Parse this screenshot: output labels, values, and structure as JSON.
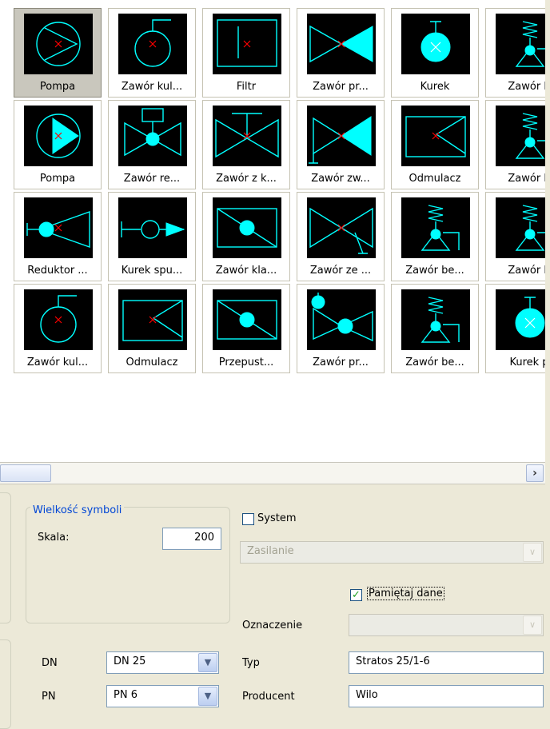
{
  "gallery": {
    "items": [
      {
        "label": "Pompa",
        "icon": "pump-icon",
        "selected": true
      },
      {
        "label": "Zawór kul...",
        "icon": "ball-valve-icon"
      },
      {
        "label": "Filtr",
        "icon": "filter-icon"
      },
      {
        "label": "Zawór pr...",
        "icon": "check-valve-icon"
      },
      {
        "label": "Kurek",
        "icon": "cock-icon"
      },
      {
        "label": "Zawór b",
        "icon": "safety-valve-icon"
      },
      {
        "label": "Pompa",
        "icon": "pump-filled-icon"
      },
      {
        "label": "Zawór re...",
        "icon": "regulating-valve-icon"
      },
      {
        "label": "Zawór z k...",
        "icon": "valve-with-handle-icon"
      },
      {
        "label": "Zawór zw...",
        "icon": "non-return-valve-icon"
      },
      {
        "label": "Odmulacz",
        "icon": "sludge-separator-icon"
      },
      {
        "label": "Zawór b",
        "icon": "safety-valve-icon"
      },
      {
        "label": "Reduktor ...",
        "icon": "pressure-reducer-icon"
      },
      {
        "label": "Kurek spu...",
        "icon": "drain-cock-icon"
      },
      {
        "label": "Zawór kla...",
        "icon": "flap-valve-icon"
      },
      {
        "label": "Zawór ze ...",
        "icon": "valve-with-drain-icon"
      },
      {
        "label": "Zawór be...",
        "icon": "safety-valve-icon"
      },
      {
        "label": "Zawór b",
        "icon": "safety-valve-icon"
      },
      {
        "label": "Zawór kul...",
        "icon": "ball-valve-icon"
      },
      {
        "label": "Odmulacz",
        "icon": "sludge-separator-icon"
      },
      {
        "label": "Przepust...",
        "icon": "flap-valve-icon"
      },
      {
        "label": "Zawór pr...",
        "icon": "three-way-valve-icon"
      },
      {
        "label": "Zawór be...",
        "icon": "safety-valve-icon"
      },
      {
        "label": "Kurek p",
        "icon": "cock-icon"
      }
    ]
  },
  "scrollbar": {
    "right_arrow": "›"
  },
  "symbol_size": {
    "legend": "Wielkość symboli",
    "scale_label": "Skala:",
    "scale_value": "200"
  },
  "system": {
    "label": "System",
    "checked": false,
    "select_value": "Zasilanie"
  },
  "remember": {
    "label": "Pamiętaj dane",
    "checked": true
  },
  "designation": {
    "label": "Oznaczenie",
    "value": ""
  },
  "dn": {
    "label": "DN",
    "value": "DN 25"
  },
  "pn": {
    "label": "PN",
    "value": "PN 6"
  },
  "type": {
    "label": "Typ",
    "value": "Stratos 25/1-6"
  },
  "producer": {
    "label": "Producent",
    "value": "Wilo"
  },
  "colors": {
    "symbol": "#00ffff",
    "marker": "#ff0000",
    "thumb_bg": "#000000",
    "selected_bg": "#c9c7bd",
    "legend": "#0046d5"
  }
}
